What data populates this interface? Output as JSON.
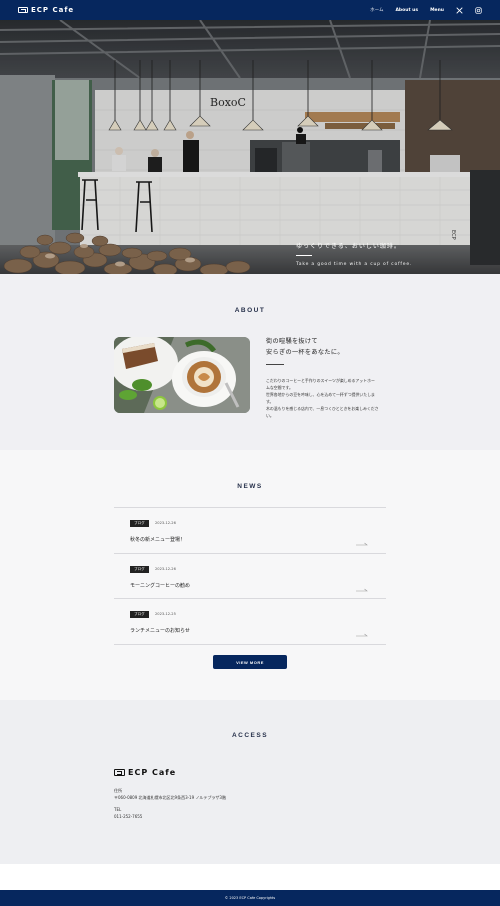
{
  "header": {
    "logo_text": "ECP Cafe",
    "nav": [
      {
        "label": "ホーム"
      },
      {
        "label": "About us"
      },
      {
        "label": "Menu"
      }
    ],
    "social_icons": [
      "x-icon",
      "instagram-icon"
    ]
  },
  "hero": {
    "catch_jp": "ゆっくりできる、おいしい珈琲。",
    "catch_en": "Take a good time with a cup of coffee."
  },
  "about": {
    "title": "ABOUT",
    "lead_line1": "街の喧騒を抜けて",
    "lead_line2": "安らぎの一杯をあなたに。",
    "body_line1": "こだわりのコーヒーと手作りのスイーツが楽しめるアットホー",
    "body_line2": "ムな空間です。",
    "body_line3": "世界各地からの豆を吟味し、心を込めて一杯ずつ提供いたしま",
    "body_line4": "す。",
    "body_line5": "木の温もりを感じる店内で、一息つくひとときをお楽しみくださ",
    "body_line6": "い。"
  },
  "news": {
    "title": "NEWS",
    "items": [
      {
        "tag": "ブログ",
        "date": "2023-12-26",
        "title": "秋冬の新メニュー登場！"
      },
      {
        "tag": "ブログ",
        "date": "2023-12-26",
        "title": "モーニングコーヒーの勧め"
      },
      {
        "tag": "ブログ",
        "date": "2023-12-25",
        "title": "ランチメニューのお知らせ"
      }
    ],
    "view_more": "VIEW MORE"
  },
  "access": {
    "title": "ACCESS",
    "logo_text": "ECP Cafe",
    "address_label": "住所",
    "address": "〒060-0809 北海道札幌市北区北9条西3-19 ノルテプラザ3階",
    "tel_label": "TEL",
    "tel": "011-252-7655"
  },
  "footer": {
    "copyright": "© 2023 ECP Cafe Copyrights"
  },
  "colors": {
    "navy": "#06275e",
    "about_bg": "#f0f0f3",
    "news_bg": "#f7f7f8",
    "access_bg": "#eeeff2"
  }
}
